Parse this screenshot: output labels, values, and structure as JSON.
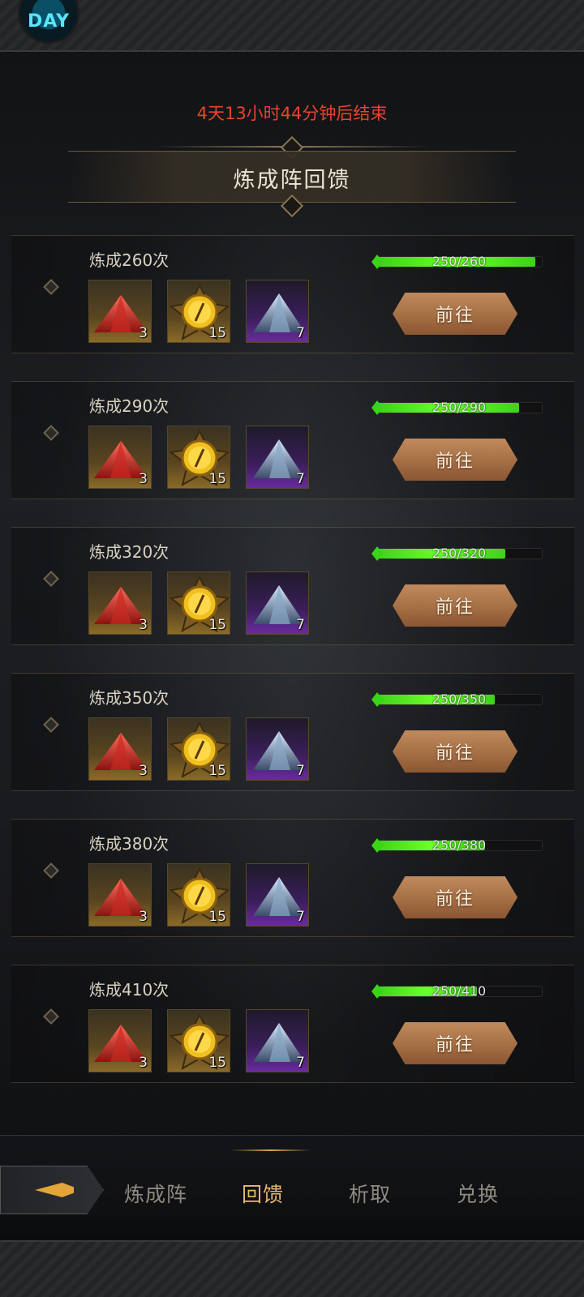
{
  "logo": {
    "label": "DAY"
  },
  "header": {
    "countdown": "4天13小时44分钟后结束",
    "title": "炼成阵回馈"
  },
  "rewards": [
    {
      "label": "炼成260次",
      "progress_text": "250/260",
      "progress": 0.9615,
      "button": "前往",
      "items": [
        {
          "icon": "red-crystal-pile-icon",
          "count": "3"
        },
        {
          "icon": "golden-eye-orb-icon",
          "count": "15"
        },
        {
          "icon": "blue-crystal-pile-icon",
          "count": "7"
        }
      ]
    },
    {
      "label": "炼成290次",
      "progress_text": "250/290",
      "progress": 0.862,
      "button": "前往",
      "items": [
        {
          "icon": "red-crystal-pile-icon",
          "count": "3"
        },
        {
          "icon": "golden-eye-orb-icon",
          "count": "15"
        },
        {
          "icon": "blue-crystal-pile-icon",
          "count": "7"
        }
      ]
    },
    {
      "label": "炼成320次",
      "progress_text": "250/320",
      "progress": 0.781,
      "button": "前往",
      "items": [
        {
          "icon": "red-crystal-pile-icon",
          "count": "3"
        },
        {
          "icon": "golden-eye-orb-icon",
          "count": "15"
        },
        {
          "icon": "blue-crystal-pile-icon",
          "count": "7"
        }
      ]
    },
    {
      "label": "炼成350次",
      "progress_text": "250/350",
      "progress": 0.714,
      "button": "前往",
      "items": [
        {
          "icon": "red-crystal-pile-icon",
          "count": "3"
        },
        {
          "icon": "golden-eye-orb-icon",
          "count": "15"
        },
        {
          "icon": "blue-crystal-pile-icon",
          "count": "7"
        }
      ]
    },
    {
      "label": "炼成380次",
      "progress_text": "250/380",
      "progress": 0.658,
      "button": "前往",
      "items": [
        {
          "icon": "red-crystal-pile-icon",
          "count": "3"
        },
        {
          "icon": "golden-eye-orb-icon",
          "count": "15"
        },
        {
          "icon": "blue-crystal-pile-icon",
          "count": "7"
        }
      ]
    },
    {
      "label": "炼成410次",
      "progress_text": "250/410",
      "progress": 0.61,
      "button": "前往",
      "items": [
        {
          "icon": "red-crystal-pile-icon",
          "count": "3"
        },
        {
          "icon": "golden-eye-orb-icon",
          "count": "15"
        },
        {
          "icon": "blue-crystal-pile-icon",
          "count": "7"
        }
      ]
    }
  ],
  "nav": {
    "back_icon": "gold-arrow-back-icon",
    "tabs": [
      {
        "label": "炼成阵",
        "active": false
      },
      {
        "label": "回馈",
        "active": true
      },
      {
        "label": "析取",
        "active": false
      },
      {
        "label": "兑换",
        "active": false
      }
    ]
  },
  "colors": {
    "countdown": "#e8442c",
    "progress_fill": "#3fd11a",
    "button": "#a56f45",
    "active_tab": "#e8b870"
  }
}
